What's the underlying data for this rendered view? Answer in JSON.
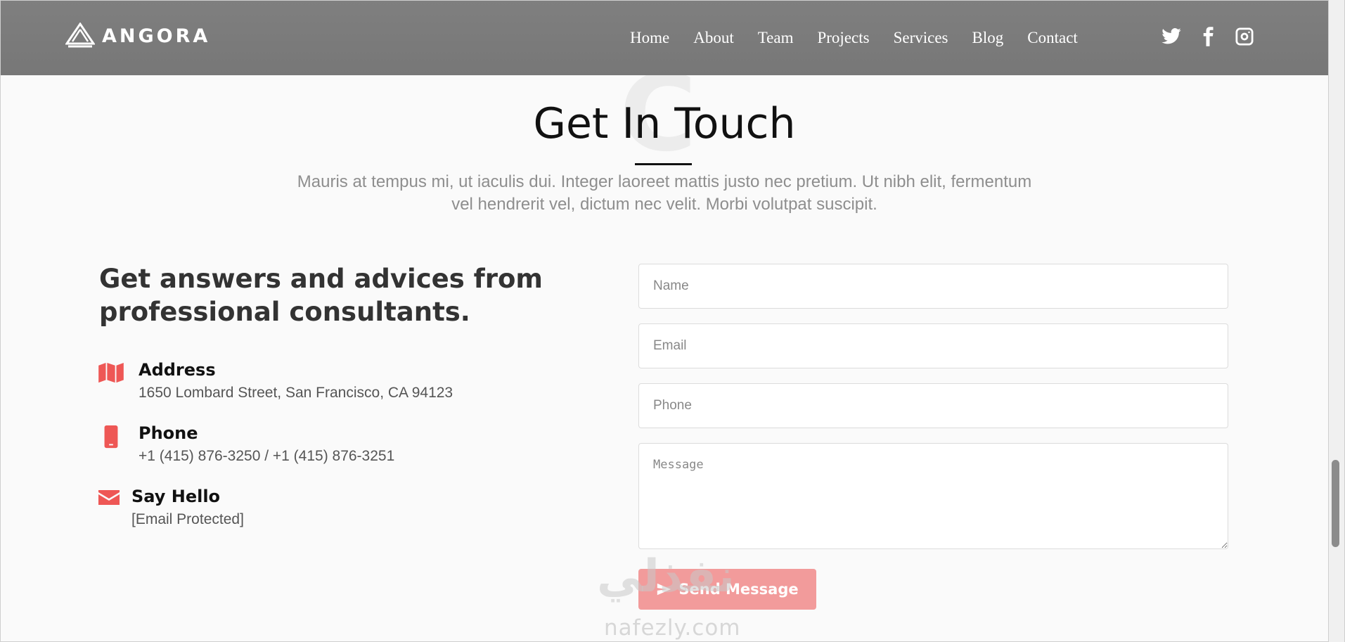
{
  "brand": {
    "name": "ANGORA",
    "logo_icon": "angora-logo-icon"
  },
  "nav": {
    "items": [
      {
        "label": "Home"
      },
      {
        "label": "About"
      },
      {
        "label": "Team"
      },
      {
        "label": "Projects"
      },
      {
        "label": "Services"
      },
      {
        "label": "Blog"
      },
      {
        "label": "Contact"
      }
    ]
  },
  "social": {
    "icons": [
      "twitter-icon",
      "facebook-icon",
      "instagram-icon"
    ]
  },
  "section": {
    "title": "Get In Touch",
    "background_letter": "C",
    "subtitle": "Mauris at tempus mi, ut iaculis dui. Integer laoreet mattis justo nec pretium. Ut nibh elit, fermentum vel hendrerit vel, dictum nec velit. Morbi volutpat suscipit."
  },
  "contact_info": {
    "lead": "Get answers and advices from professional consultants.",
    "items": [
      {
        "icon": "map-icon",
        "title": "Address",
        "text": "1650 Lombard Street, San Francisco, CA 94123"
      },
      {
        "icon": "mobile-phone-icon",
        "title": "Phone",
        "text": "+1 (415) 876-3250 / +1 (415) 876-3251"
      },
      {
        "icon": "envelope-icon",
        "title": "Say Hello",
        "text": "[Email Protected]"
      }
    ]
  },
  "form": {
    "name_placeholder": "Name",
    "email_placeholder": "Email",
    "phone_placeholder": "Phone",
    "message_placeholder": "Message",
    "submit_label": "Send Message",
    "submit_icon": "paper-plane-icon"
  },
  "watermark": {
    "arabic": "نفذلي",
    "latin": "nafezly.com"
  },
  "colors": {
    "accent": "#ee5755",
    "button": "#f29b9b",
    "header": "#7c7c7c"
  }
}
